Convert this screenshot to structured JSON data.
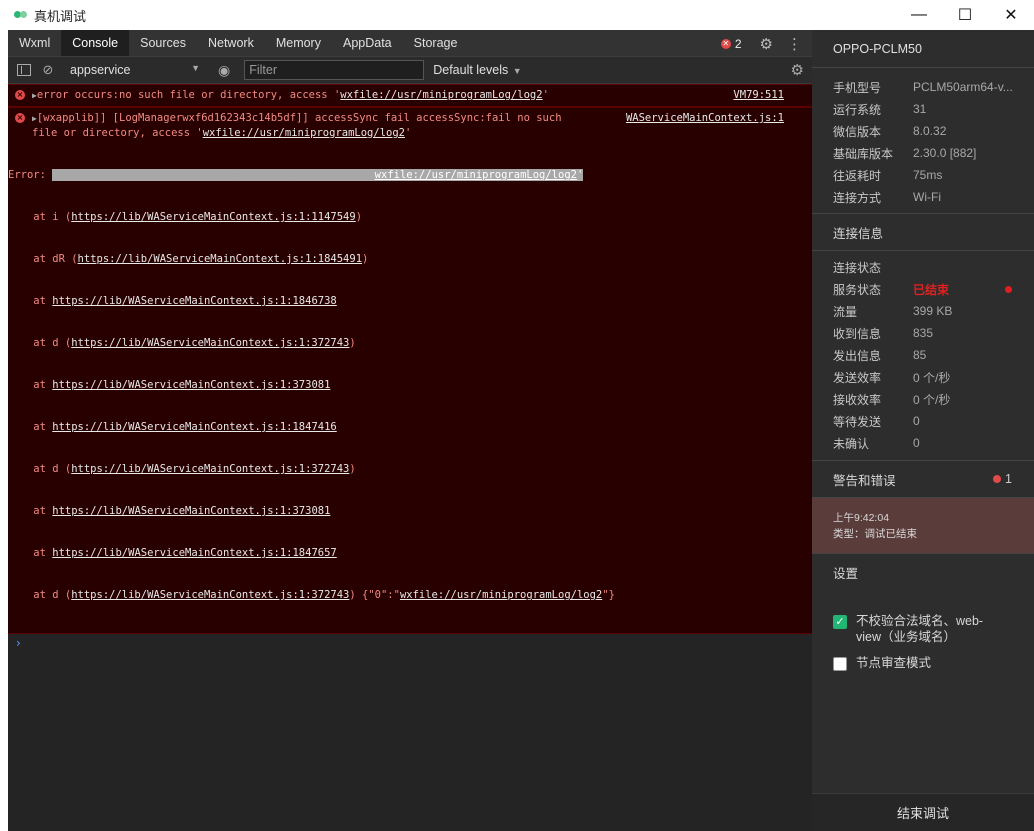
{
  "window": {
    "title": "真机调试",
    "controls": {
      "minimize": "—",
      "maximize": "☐",
      "close": "✕"
    }
  },
  "devtools": {
    "tabs": [
      {
        "label": "Wxml"
      },
      {
        "label": "Console",
        "active": true
      },
      {
        "label": "Sources"
      },
      {
        "label": "Network"
      },
      {
        "label": "Memory"
      },
      {
        "label": "AppData"
      },
      {
        "label": "Storage"
      }
    ],
    "error_count": "2",
    "toolbar": {
      "context": "appservice",
      "filter_placeholder": "Filter",
      "levels": "Default levels"
    },
    "console": {
      "msg1": {
        "text": "error occurs:no such file or directory, access '",
        "path": "wxfile://usr/miniprogramLog/log2",
        "suffix": "'",
        "source": "VM79:511"
      },
      "msg2": {
        "line1": "[wxapplib]] [LogManagerwxf6d162343c14b5df]] accessSync fail accessSync:fail no such",
        "source": "WAServiceMainContext.js:1",
        "line2_pre": "file or directory, access '",
        "line2_path": "wxfile://usr/miniprogramLog/log2",
        "line2_post": "'",
        "error_pre": "Error: ",
        "error_hidden": "accessSync:fail no such file or directory, access '",
        "error_path": "wxfile://usr/miniprogramLog/log2",
        "error_post": "'",
        "stack": [
          {
            "pre": "    at i (",
            "url": "https://lib/WAServiceMainContext.js:1:1147549",
            "post": ")"
          },
          {
            "pre": "    at dR (",
            "url": "https://lib/WAServiceMainContext.js:1:1845491",
            "post": ")"
          },
          {
            "pre": "    at ",
            "url": "https://lib/WAServiceMainContext.js:1:1846738",
            "post": ""
          },
          {
            "pre": "    at d (",
            "url": "https://lib/WAServiceMainContext.js:1:372743",
            "post": ")"
          },
          {
            "pre": "    at ",
            "url": "https://lib/WAServiceMainContext.js:1:373081",
            "post": ""
          },
          {
            "pre": "    at ",
            "url": "https://lib/WAServiceMainContext.js:1:1847416",
            "post": ""
          },
          {
            "pre": "    at d (",
            "url": "https://lib/WAServiceMainContext.js:1:372743",
            "post": ")"
          },
          {
            "pre": "    at ",
            "url": "https://lib/WAServiceMainContext.js:1:373081",
            "post": ""
          },
          {
            "pre": "    at ",
            "url": "https://lib/WAServiceMainContext.js:1:1847657",
            "post": ""
          },
          {
            "pre": "    at d (",
            "url": "https://lib/WAServiceMainContext.js:1:372743",
            "post": ") {\"0\":\""
          }
        ],
        "last_path": "wxfile://usr/miniprogramLog/log2",
        "last_post": "\"}"
      },
      "prompt": "›"
    }
  },
  "panel": {
    "device": "OPPO-PCLM50",
    "device_info": [
      {
        "k": "手机型号",
        "v": "PCLM50arm64-v..."
      },
      {
        "k": "运行系统",
        "v": "31"
      },
      {
        "k": "微信版本",
        "v": "8.0.32"
      },
      {
        "k": "基础库版本",
        "v": "2.30.0 [882]"
      },
      {
        "k": "往返耗时",
        "v": "75ms"
      },
      {
        "k": "连接方式",
        "v": "Wi-Fi"
      }
    ],
    "conn_title": "连接信息",
    "conn_status_label": "连接状态",
    "conn_info": [
      {
        "k": "服务状态",
        "v": "已结束",
        "status": true
      },
      {
        "k": "流量",
        "v": "399 KB"
      },
      {
        "k": "收到信息",
        "v": "835"
      },
      {
        "k": "发出信息",
        "v": "85"
      },
      {
        "k": "发送效率",
        "v": "0 个/秒"
      },
      {
        "k": "接收效率",
        "v": "0 个/秒"
      },
      {
        "k": "等待发送",
        "v": "0"
      },
      {
        "k": "未确认",
        "v": "0"
      }
    ],
    "warn_title": "警告和错误",
    "warn_count": "1",
    "alert_time": "上午9:42:04",
    "alert_type": "类型：调试已结束",
    "settings_title": "设置",
    "opt1": "不校验合法域名、web-view（业务域名）",
    "opt1_checked": true,
    "opt2": "节点审查模式",
    "opt2_checked": false,
    "end_button": "结束调试",
    "colors": {
      "status_red": "#e02020",
      "check_green": "#22b573",
      "alert_bg": "#5a3c3b"
    }
  }
}
